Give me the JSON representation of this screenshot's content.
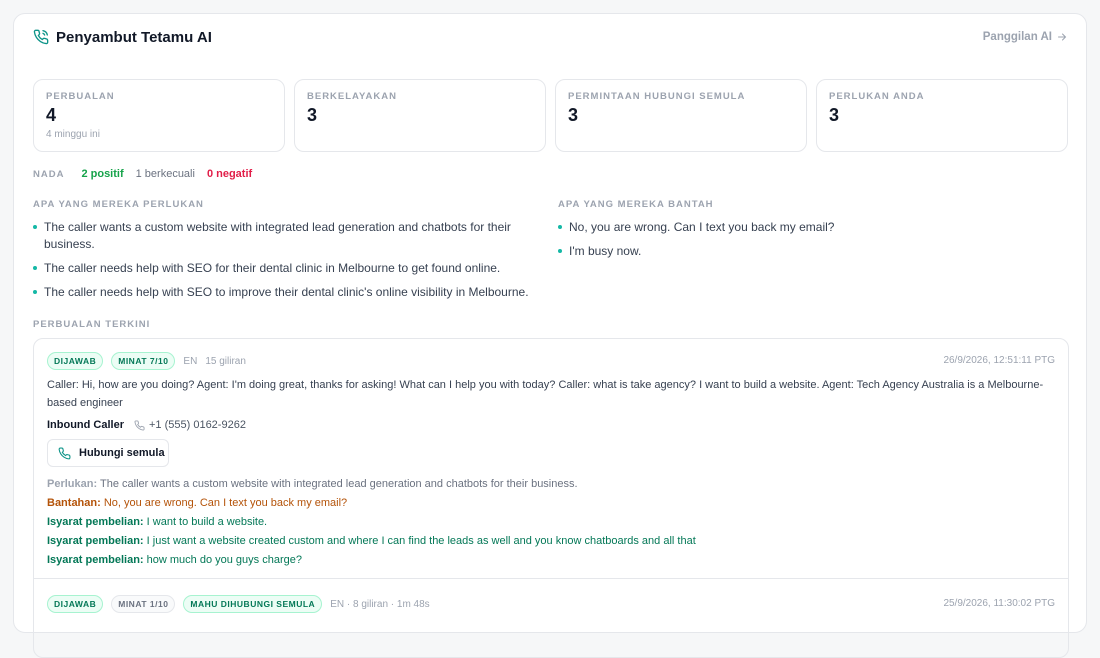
{
  "header": {
    "title": "Penyambut Tetamu AI",
    "link_label": "Panggilan AI"
  },
  "stats": [
    {
      "label": "PERBUALAN",
      "value": "4",
      "sub": "4 minggu ini"
    },
    {
      "label": "BERKELAYAKAN",
      "value": "3",
      "sub": ""
    },
    {
      "label": "PERMINTAAN HUBUNGI SEMULA",
      "value": "3",
      "sub": ""
    },
    {
      "label": "PERLUKAN ANDA",
      "value": "3",
      "sub": ""
    }
  ],
  "tone": {
    "label": "NADA",
    "positive": "2 positif",
    "neutral": "1 berkecuali",
    "negative": "0 negatif"
  },
  "needs": {
    "heading": "APA YANG MEREKA PERLUKAN",
    "items": [
      "The caller wants a custom website with integrated lead generation and chatbots for their business.",
      "The caller needs help with SEO for their dental clinic in Melbourne to get found online.",
      "The caller needs help with SEO to improve their dental clinic's online visibility in Melbourne."
    ]
  },
  "helps": {
    "heading": "APA YANG MEREKA BANTAH",
    "items": [
      "No, you are wrong. Can I text you back my email?",
      "I'm busy now."
    ]
  },
  "recent": {
    "heading": "PERBUALAN TERKINI",
    "call1": {
      "badge_answered": "DIJAWAB",
      "badge_interest": "MINAT 7/10",
      "lang": "EN",
      "turns": "15 giliran",
      "timestamp": "26/9/2026, 12:51:11 PTG",
      "transcript": "Caller: Hi, how are you doing? Agent: I'm doing great, thanks for asking! What can I help you with today? Caller: what is take agency? I want to build a website. Agent: Tech Agency Australia is a Melbourne-based engineer",
      "caller_name": "Inbound Caller",
      "caller_number": "+1 (555) 0162-9262",
      "callback_label": "Hubungi semula",
      "need_key": "Perlukan:",
      "need_val": "The caller wants a custom website with integrated lead generation and chatbots for their business.",
      "help_key": "Bantahan:",
      "help_val": "No, you are wrong. Can I text you back my email?",
      "buy_key": "Isyarat pembelian:",
      "buy_1": "I want to build a website.",
      "buy_2": "I just want a website created custom and where I can find the leads as well and you know chatboards and all that",
      "buy_3": "how much do you guys charge?"
    },
    "call2": {
      "badge_answered": "DIJAWAB",
      "badge_interest": "MINAT 1/10",
      "badge_callback": "MAHU DIHUBUNGI SEMULA",
      "meta": "EN · 8 giliran · 1m 48s",
      "timestamp": "25/9/2026, 11:30:02 PTG"
    }
  }
}
